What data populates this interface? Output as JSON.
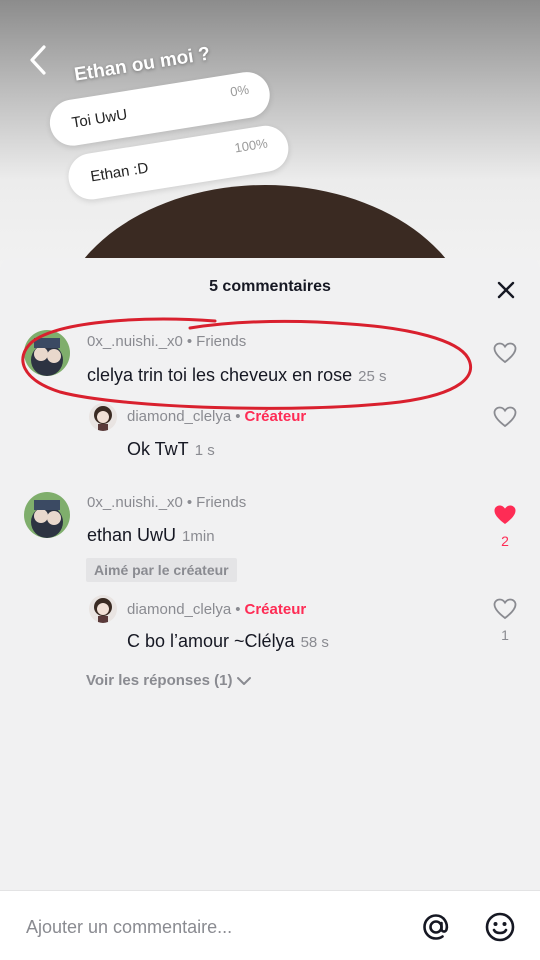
{
  "poll": {
    "question": "Ethan ou moi ?",
    "options": [
      {
        "label": "Toi UwU",
        "percent": "0%"
      },
      {
        "label": "Ethan :D",
        "percent": "100%"
      }
    ]
  },
  "sheet": {
    "title": "5 commentaires"
  },
  "comments": [
    {
      "username": "0x_.nuishi._x0",
      "tag": "Friends",
      "text": "clelya trin toi les cheveux en rose",
      "time": "25 s",
      "likes": "",
      "liked": false
    },
    {
      "username": "diamond_clelya",
      "tag": "Créateur",
      "text": "Ok TwT",
      "time": "1 s",
      "likes": "",
      "liked": false
    },
    {
      "username": "0x_.nuishi._x0",
      "tag": "Friends",
      "text": "ethan UwU",
      "time": "1min",
      "likes": "2",
      "liked": true,
      "badge": "Aimé par le créateur"
    },
    {
      "username": "diamond_clelya",
      "tag": "Créateur",
      "text": "C bo l’amour ~Clélya",
      "time": "58 s",
      "likes": "1",
      "liked": false
    }
  ],
  "replies_link": "Voir les réponses (1)",
  "input": {
    "placeholder": "Ajouter un commentaire..."
  },
  "colors": {
    "accent": "#fe2c55",
    "annotation": "#d9202e"
  },
  "icons": [
    "back-icon",
    "close-icon",
    "heart-outline-icon",
    "heart-filled-icon",
    "chevron-down-icon",
    "at-icon",
    "emoji-icon"
  ]
}
